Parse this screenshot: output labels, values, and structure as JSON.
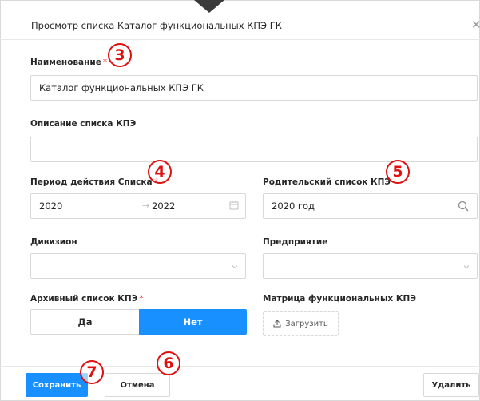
{
  "dialog": {
    "title": "Просмотр списка Каталог функциональных КПЭ ГК",
    "close_glyph": "✕"
  },
  "form": {
    "name_label": "Наименование",
    "name_value": "Каталог функциональных КПЭ ГК",
    "description_label": "Описание списка КПЭ",
    "description_value": "",
    "period_label": "Период действия Списка",
    "period_start": "2020",
    "period_arrow": "→",
    "period_end": "2022",
    "parent_label": "Родительский список КПЭ",
    "parent_value": "2020 год",
    "division_label": "Дивизион",
    "division_value": "",
    "enterprise_label": "Предприятие",
    "enterprise_value": "",
    "archive_label": "Архивный список КПЭ",
    "archive_yes": "Да",
    "archive_no": "Нет",
    "archive_selected": "Нет",
    "matrix_label": "Матрица функциональных КПЭ",
    "upload_label": "Загрузить",
    "required_mark": "*"
  },
  "footer": {
    "save_label": "Сохранить",
    "cancel_label": "Отмена",
    "delete_label": "Удалить"
  },
  "annotations": [
    "3",
    "4",
    "5",
    "6",
    "7"
  ],
  "colors": {
    "primary": "#1890ff",
    "required": "#f5222d",
    "annotation": "#e01010"
  },
  "icons": [
    "calendar-icon",
    "search-icon",
    "chevron-down-icon",
    "upload-icon",
    "close-icon"
  ]
}
